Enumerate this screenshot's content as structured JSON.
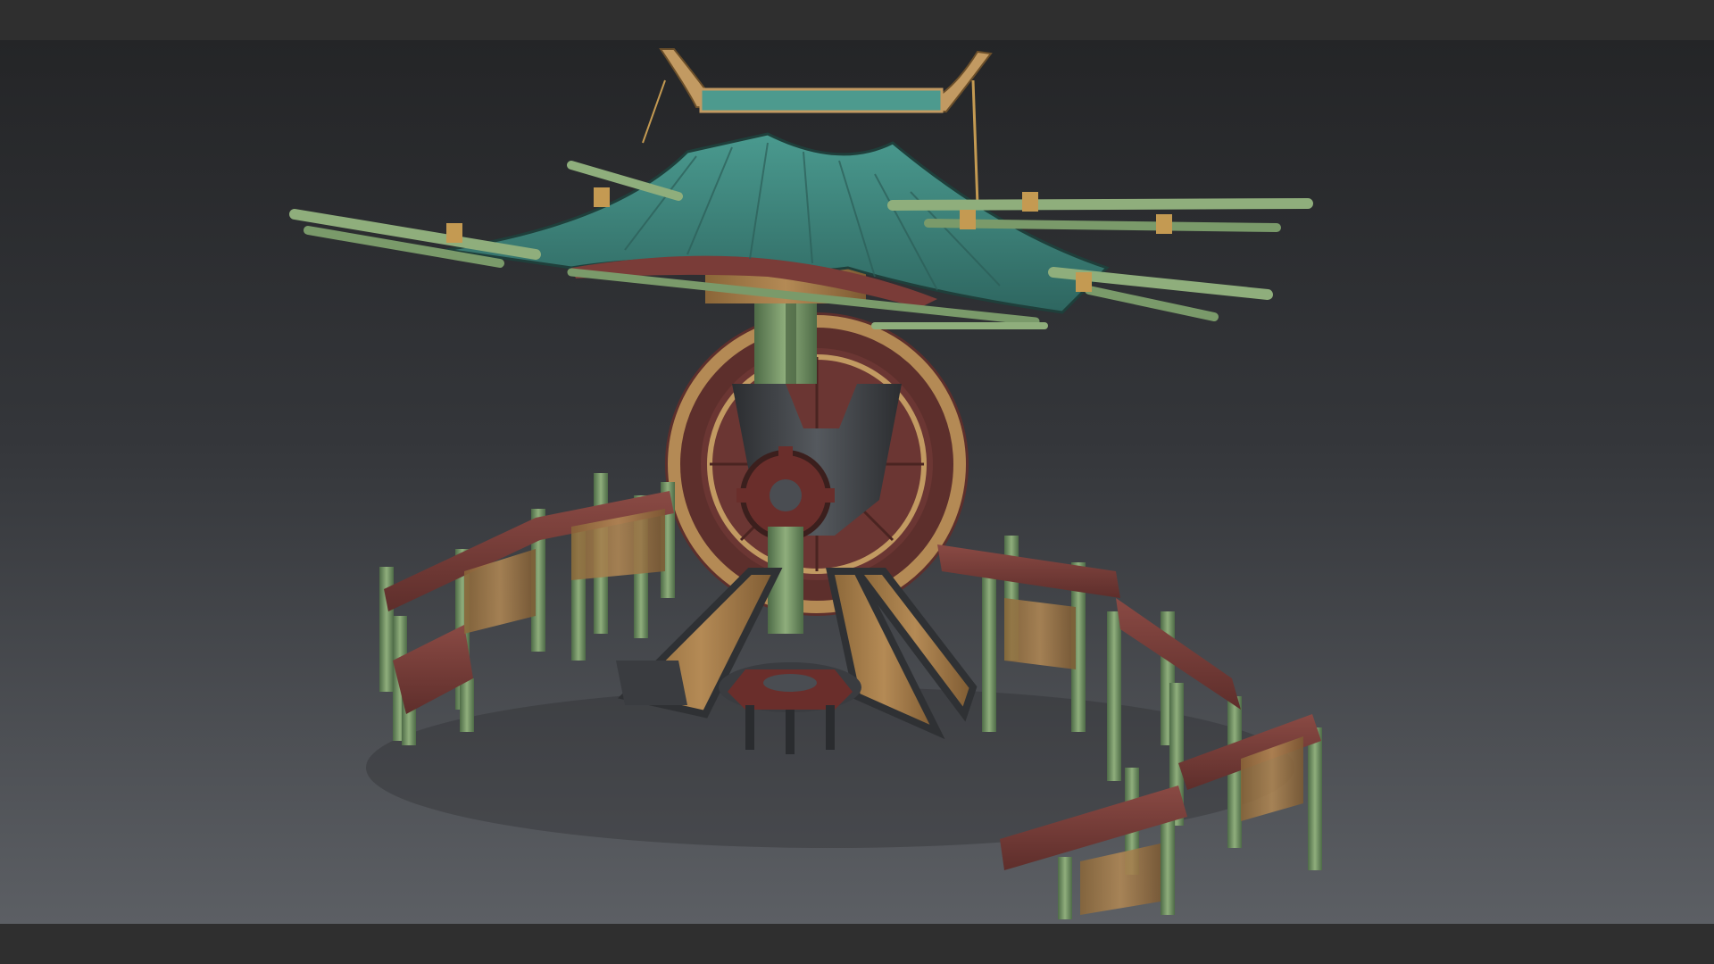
{
  "scene": {
    "subject": "stylized-asian-watermill-3d-model",
    "colors": {
      "roof_teal": "#3f8f86",
      "roof_teal_dark": "#2a5f5a",
      "bamboo_green": "#7a9a6a",
      "bamboo_dark": "#4c6a44",
      "wood_tan": "#a9824f",
      "wood_red": "#7a3c38",
      "iron_dark": "#3b3e42",
      "rope": "#c49a52",
      "background_top": "#242527",
      "background_bottom": "#5c5f64",
      "letterbox": "#2f2f2f"
    }
  }
}
